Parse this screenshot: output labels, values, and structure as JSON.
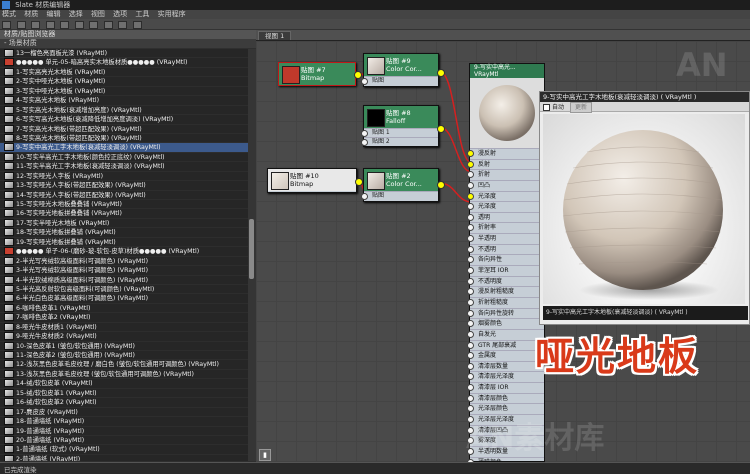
{
  "window": {
    "title": "Slate 材质编辑器"
  },
  "menu": [
    "模式",
    "材质",
    "编辑",
    "选择",
    "视图",
    "选项",
    "工具",
    "实用程序"
  ],
  "left_panel": {
    "header": "材质/贴图浏览器",
    "sub_header": "- 场景材质",
    "items": [
      "13一榴色亮面板光漆 (VRayMtl)",
      "●●●●● 单元-05-暗高亮实木地板材质●●●●● (VRayMtl)",
      "1-写实高亮光木地板 (VRayMtl)",
      "2-写实中哑光木地板 (VRayMtl)",
      "3-写实中哑光木地板 (VRayMtl)",
      "4-写实高光木地板 (VRayMtl)",
      "5-写实高光木地板(衰减增加亮度) (VRayMtl)",
      "6-写实写高光木地板(衰减降低增加亮度调淡) (VRayMtl)",
      "7-写实高光木地板(带超匹配效果) (VRayMtl)",
      "8-写实高光木地板(带超匹配效果) (VRayMtl)",
      "9-写实中高光工字木地板(衰减轻淡调淡) (VRayMtl)",
      "10-写实半高光工字木地板(颜色控正底纹) (VRayMtl)",
      "11-写实半高光工字木地板(衰减轻淡调淡) (VRayMtl)",
      "12-写实哑光人字板 (VRayMtl)",
      "13-写实哑光人字板(带超匹配效果) (VRayMtl)",
      "14-写实哑光人字板(带超匹配效果) (VRayMtl)",
      "15-写实哑光木地板叠叠铺 (VRayMtl)",
      "16-写实哑光地板拼叠叠铺 (VRayMtl)",
      "17-写实半哑光木地板 (VRayMtl)",
      "18-写实哑光地板拼叠铺 (VRayMtl)",
      "19-写实哑光地板拼叠铺 (VRayMtl)",
      "●●●●● 单子-06-(磨砂-玻-软包-皮草)材质●●●●● (VRayMtl)",
      "2-半光写亮绒软高级面料(可调颜色) (VRayMtl)",
      "3-半光写亮绒软高级面料(可调颜色) (VRayMtl)",
      "4-半光软绒棉质高级面料(可调颜色) (VRayMtl)",
      "5-半光高反射软包高级面料(可调颜色) (VRayMtl)",
      "6-半光白色皮革高级面料(可调颜色) (VRayMtl)",
      "6-咖啡色皮革1 (VRayMtl)",
      "7-咖啡色皮革2 (VRayMtl)",
      "8-哑光牛皮材质1 (VRayMtl)",
      "9-哑光牛皮材质2 (VRayMtl)",
      "10-深色皮革1 (皱包/软包通用) (VRayMtl)",
      "11-深色皮革2 (皱包/软包通用) (VRayMtl)",
      "12-浅灰黑色皮革毛皮纹理 / 磨白色 (皱包/软包通用可调颜色) (VRayMtl)",
      "13-浅灰黑色皮革毛皮纹理 (皱包/软包通用可调颜色) (VRayMtl)",
      "14-绒/软包皮革 (VRayMtl)",
      "15-绒/软包皮革1 (VRayMtl)",
      "16-绒/软包皮革2 (VRayMtl)",
      "17-麂皮皮 (VRayMtl)",
      "18-普通墙纸 (VRayMtl)",
      "19-普通墙纸 (VRayMtl)",
      "20-普通墙纸 (VRayMtl)",
      "1-普通墙纸 (软式) (VRayMtl)",
      "2-普通墙纸 (VRayMtl)",
      "21-布料 沙发面布布艺 (VRayMtl)",
      "●●●●● 单子-07-写实布料 沙发面布布艺●●●●● (VRayMtl)",
      "1-写实布纹1 (VRayMtl)"
    ],
    "selected_index": 10
  },
  "view_tab": "视图 1",
  "nodes": {
    "map7": {
      "title": "贴图 #7",
      "subtitle": "Bitmap"
    },
    "map9": {
      "title": "贴图 #9",
      "subtitle": "Color Cor...",
      "port": "贴图"
    },
    "map8": {
      "title": "贴图 #8",
      "subtitle": "Falloff",
      "ports": [
        "贴图 1",
        "贴图 2"
      ]
    },
    "map10": {
      "title": "贴图 #10",
      "subtitle": "Bitmap"
    },
    "map2": {
      "title": "贴图 #2",
      "subtitle": "Color Cor...",
      "port": "贴图"
    },
    "vray": {
      "title": "9-写实中高光...",
      "subtitle": "VRayMtl",
      "ports": [
        "漫反射",
        "反射",
        "折射",
        "凹凸",
        "光泽度",
        "光泽度",
        "透明",
        "折射率",
        "半透明",
        "不透明",
        "各向异性",
        "菲涅耳 IOR",
        "不透明度",
        "漫反射粗糙度",
        "折射粗糙度",
        "各向异性旋转",
        "烟雾颜色",
        "自发光",
        "GTR 尾部衰减",
        "金属度",
        "清漆层数量",
        "清漆层光泽度",
        "清漆层 IOR",
        "清漆层颜色",
        "光泽层颜色",
        "光泽层光泽度",
        "清漆层凹凸",
        "雾深度",
        "半透明数量",
        "薄膜颜色",
        "薄膜 IOR"
      ]
    }
  },
  "preview": {
    "title": "9-写实中高光工字木地板(衰减轻淡调淡) ( VRayMtl )",
    "auto_label": "自动",
    "update_label": "更新",
    "footer": "9-写实中高光工字木地板(衰减轻淡调淡) ( VRayMtl )"
  },
  "overlay_label": "哑光地板",
  "watermarks": [
    "AN",
    "AN素材库"
  ],
  "status": "已完成渲染"
}
